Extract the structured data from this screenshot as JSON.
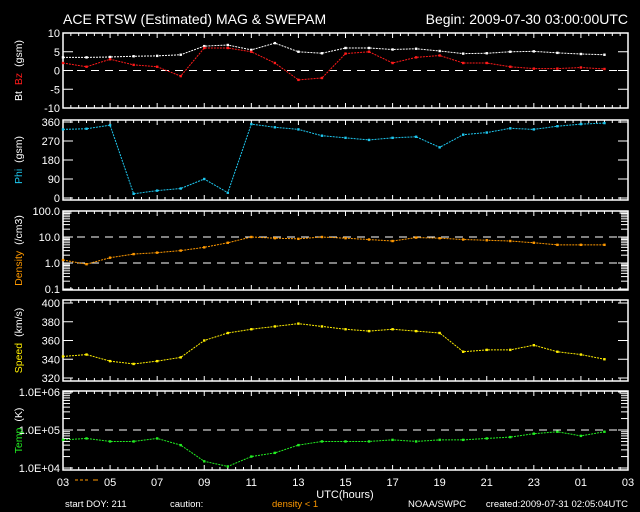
{
  "header": {
    "title": "ACE RTSW (Estimated) MAG & SWEPAM",
    "begin": "Begin: 2009-07-30 03:00:00UTC"
  },
  "footer": {
    "start_doy": "start DOY: 211",
    "caution": "caution:",
    "caution_note": "density < 1",
    "source": "NOAA/SWPC",
    "created": "created:2009-07-31 02:05:04UTC"
  },
  "colors": {
    "bt": "#ffffff",
    "bz": "#ff1a1a",
    "phi": "#1ec8f0",
    "density": "#ff9900",
    "speed": "#ffee00",
    "temp": "#22ee22"
  },
  "chart_data": {
    "type": "scatter",
    "title": "ACE RTSW (Estimated) MAG & SWEPAM",
    "xlabel": "UTC(hours)",
    "x_tick_labels": [
      "03",
      "05",
      "07",
      "09",
      "11",
      "13",
      "15",
      "17",
      "19",
      "21",
      "23",
      "01",
      "03"
    ],
    "xlim_hours_from_start": [
      0,
      24
    ],
    "x": [
      0,
      1,
      2,
      3,
      4,
      5,
      6,
      7,
      8,
      9,
      10,
      11,
      12,
      13,
      14,
      15,
      16,
      17,
      18,
      19,
      20,
      21,
      22,
      23
    ],
    "panels": [
      {
        "name": "mag",
        "ylabel_parts": [
          "Bt",
          "Bz",
          "(gsm)"
        ],
        "scale": "linear",
        "ylim": [
          -10,
          10
        ],
        "yticks": [
          "10",
          "5",
          "0",
          "-5",
          "-10"
        ],
        "ytick_values": [
          10,
          5,
          0,
          -5,
          -10
        ],
        "dashed_at": [
          0
        ],
        "series": [
          {
            "name": "Bt",
            "color_key": "bt",
            "values": [
              3.5,
              3.5,
              3.6,
              3.8,
              3.9,
              4.2,
              6.5,
              6.8,
              5.5,
              7.3,
              5,
              4.6,
              6,
              6,
              5.6,
              5.8,
              5.2,
              4.5,
              4.6,
              5,
              5.1,
              4.7,
              4.4,
              4.2
            ]
          },
          {
            "name": "Bz",
            "color_key": "bz",
            "values": [
              2,
              1,
              3,
              1.5,
              1,
              -1.5,
              6,
              6,
              5,
              2,
              -2.5,
              -2,
              4.5,
              5,
              2,
              3.5,
              4,
              2,
              2,
              1,
              0.5,
              0.5,
              0.8,
              0.4
            ]
          }
        ]
      },
      {
        "name": "phi",
        "ylabel_parts": [
          "Phi",
          "(gsm)"
        ],
        "scale": "linear",
        "ylim": [
          0,
          360
        ],
        "yticks": [
          "360",
          "270",
          "180",
          "90",
          "0"
        ],
        "ytick_values": [
          360,
          270,
          180,
          90,
          0
        ],
        "dashed_at": [],
        "series": [
          {
            "name": "Phi",
            "color_key": "phi",
            "values": [
              325,
              328,
              345,
              20,
              35,
              45,
              90,
              25,
              350,
              335,
              325,
              295,
              285,
              275,
              285,
              290,
              240,
              300,
              310,
              330,
              325,
              340,
              350,
              355
            ]
          }
        ]
      },
      {
        "name": "density",
        "ylabel_parts": [
          "Density",
          "(/cm3)"
        ],
        "scale": "log",
        "ylim": [
          0.1,
          100
        ],
        "yticks": [
          "100.0",
          "10.0",
          "1.0",
          "0.1"
        ],
        "ytick_values": [
          100,
          10,
          1,
          0.1
        ],
        "dashed_at": [
          10,
          1
        ],
        "series": [
          {
            "name": "Density",
            "color_key": "density",
            "values": [
              1.3,
              0.9,
              1.6,
              2.2,
              2.5,
              3,
              4,
              6,
              10,
              9,
              8.5,
              10,
              9,
              8,
              7,
              9.5,
              9,
              8,
              7.5,
              7,
              6,
              5,
              5,
              5
            ]
          }
        ]
      },
      {
        "name": "speed",
        "ylabel_parts": [
          "Speed",
          "(km/s)"
        ],
        "scale": "linear",
        "ylim": [
          320,
          400
        ],
        "yticks": [
          "400",
          "380",
          "360",
          "340",
          "320"
        ],
        "ytick_values": [
          400,
          380,
          360,
          340,
          320
        ],
        "dashed_at": [],
        "series": [
          {
            "name": "Speed",
            "color_key": "speed",
            "values": [
              343,
              345,
              338,
              335,
              338,
              342,
              360,
              368,
              372,
              375,
              378,
              375,
              372,
              370,
              372,
              370,
              368,
              348,
              350,
              350,
              355,
              348,
              345,
              340
            ]
          }
        ]
      },
      {
        "name": "temp",
        "ylabel_parts": [
          "Temp",
          "(K)"
        ],
        "scale": "log",
        "ylim": [
          10000,
          1000000
        ],
        "yticks": [
          "1.0E+06",
          "1.0E+05",
          "1.0E+04"
        ],
        "ytick_values": [
          1000000,
          100000,
          10000
        ],
        "dashed_at": [
          100000
        ],
        "series": [
          {
            "name": "Temp",
            "color_key": "temp",
            "values": [
              55000,
              60000,
              50000,
              50000,
              60000,
              40000,
              15000,
              11000,
              20000,
              25000,
              40000,
              50000,
              50000,
              50000,
              55000,
              50000,
              55000,
              55000,
              60000,
              65000,
              80000,
              90000,
              70000,
              90000
            ]
          }
        ]
      }
    ]
  }
}
